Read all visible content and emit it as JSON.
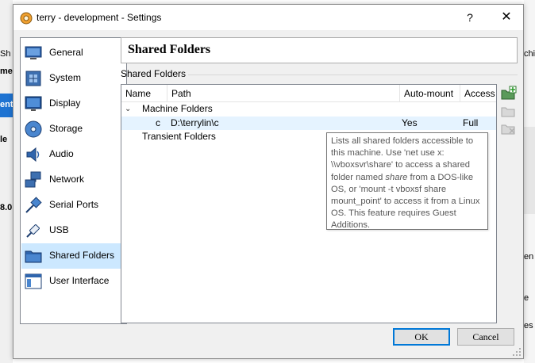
{
  "window": {
    "title": "terry - development - Settings",
    "help_glyph": "?",
    "close_glyph": "✕"
  },
  "background": {
    "left_texts": [
      "Sh",
      "me",
      "ent",
      "le",
      "8.0"
    ],
    "right_texts": [
      "chi",
      "en",
      "e",
      "es"
    ]
  },
  "sidebar": {
    "items": [
      {
        "label": "General",
        "icon": "monitor-icon"
      },
      {
        "label": "System",
        "icon": "chip-icon"
      },
      {
        "label": "Display",
        "icon": "display-icon"
      },
      {
        "label": "Storage",
        "icon": "disk-icon"
      },
      {
        "label": "Audio",
        "icon": "speaker-icon"
      },
      {
        "label": "Network",
        "icon": "network-icon"
      },
      {
        "label": "Serial Ports",
        "icon": "serial-port-icon"
      },
      {
        "label": "USB",
        "icon": "usb-icon"
      },
      {
        "label": "Shared Folders",
        "icon": "folder-icon"
      },
      {
        "label": "User Interface",
        "icon": "ui-window-icon"
      }
    ],
    "selected": "Shared Folders"
  },
  "page": {
    "title": "Shared Folders",
    "group_label": "Shared Folders"
  },
  "table": {
    "headers": [
      "Name",
      "Path",
      "Auto-mount",
      "Access"
    ],
    "groups": [
      {
        "label": "Machine Folders",
        "expanded": true,
        "rows": [
          {
            "name": "c",
            "path": "D:\\terrylin\\c",
            "auto_mount": "Yes",
            "access": "Full"
          }
        ]
      },
      {
        "label": "Transient Folders",
        "expanded": false,
        "rows": []
      }
    ],
    "expand_glyph": "⌄"
  },
  "tooltip": {
    "p1": "Lists all shared folders accessible to this machine. Use 'net use x: \\\\vboxsvr\\share' to access a shared folder named ",
    "em1": "share",
    "p2": " from a DOS-like OS, or 'mount -t vboxsf share mount_point' to access it from a Linux OS. This feature requires Guest Additions."
  },
  "buttons": {
    "ok": "OK",
    "cancel": "Cancel"
  },
  "colors": {
    "selection": "#cce8ff",
    "row_highlight": "#e5f3ff",
    "accent": "#0078d7"
  }
}
